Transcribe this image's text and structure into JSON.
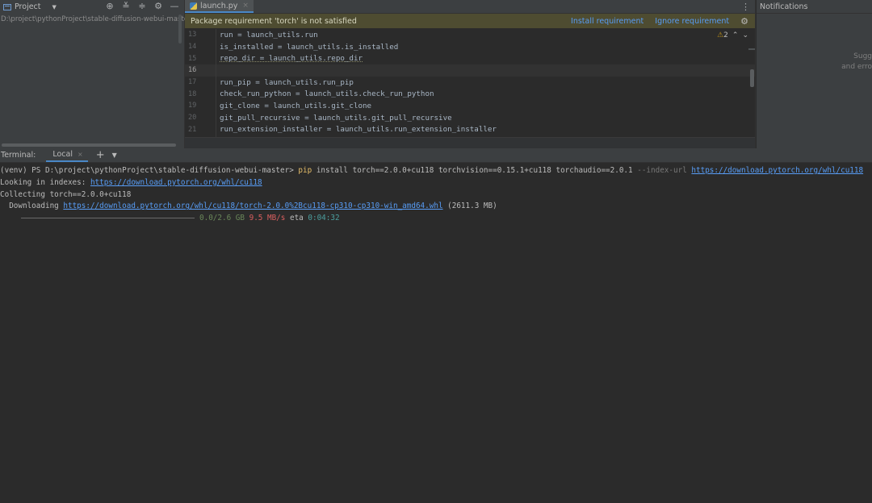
{
  "project": {
    "title": "Project",
    "path": "D:\\project\\pythonProject\\stable-diffusion-webui-master"
  },
  "editor": {
    "tab_label": "launch.py",
    "banner": {
      "message": "Package requirement 'torch' is not satisfied",
      "install_label": "Install requirement",
      "ignore_label": "Ignore requirement"
    },
    "inspection_count": "2",
    "current_line": 16,
    "lines": [
      {
        "num": "13",
        "code": "run = launch_utils.run"
      },
      {
        "num": "14",
        "code": "is_installed = launch_utils.is_installed"
      },
      {
        "num": "15",
        "code": "repo_dir = launch_utils.repo_dir"
      },
      {
        "num": "16",
        "code": ""
      },
      {
        "num": "17",
        "code": "run_pip = launch_utils.run_pip"
      },
      {
        "num": "18",
        "code": "check_run_python = launch_utils.check_run_python"
      },
      {
        "num": "19",
        "code": "git_clone = launch_utils.git_clone"
      },
      {
        "num": "20",
        "code": "git_pull_recursive = launch_utils.git_pull_recursive"
      },
      {
        "num": "21",
        "code": "run_extension_installer = launch_utils.run_extension_installer"
      }
    ]
  },
  "notifications": {
    "title": "Notifications",
    "hint_line1": "Sugg",
    "hint_line2": "and erro"
  },
  "terminal": {
    "label": "Terminal:",
    "tab_local": "Local",
    "prompt": "(venv) PS D:\\project\\pythonProject\\stable-diffusion-webui-master> ",
    "cmd_pip": "pip",
    "cmd_args": " install torch==2.0.0+cu118 torchvision==0.15.1+cu118 torchaudio==2.0.1 ",
    "cmd_flag": "--index-url",
    "cmd_url": "https://download.pytorch.org/whl/cu118",
    "looking_prefix": "Looking in indexes: ",
    "looking_url": "https://download.pytorch.org/whl/cu118",
    "collecting": "Collecting torch==2.0.0+cu118",
    "downloading_prefix": "  Downloading ",
    "downloading_url": "https://download.pytorch.org/whl/cu118/torch-2.0.0%2Bcu118-cp310-cp310-win_amd64.whl",
    "downloading_size": " (2611.3 MB)",
    "progress_fraction": 0.0,
    "progress_amount": "0.0/2.6 GB",
    "progress_speed": "9.5 MB/s",
    "progress_eta_label": "eta",
    "progress_eta": "0:04:32"
  },
  "colors": {
    "accent": "#4a88c7",
    "banner_bg": "#4e4c31",
    "link": "#589df6",
    "pip": "#e8bf6a"
  }
}
